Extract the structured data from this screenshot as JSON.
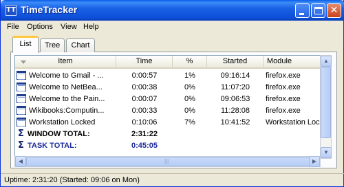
{
  "window": {
    "title": "TimeTracker",
    "icon_glyph": "TT"
  },
  "menu": [
    {
      "label": "File"
    },
    {
      "label": "Options"
    },
    {
      "label": "View"
    },
    {
      "label": "Help"
    }
  ],
  "tabs": [
    {
      "label": "List",
      "active": true
    },
    {
      "label": "Tree",
      "active": false
    },
    {
      "label": "Chart",
      "active": false
    }
  ],
  "list": {
    "columns": [
      "Item",
      "Time",
      "%",
      "Started",
      "Module"
    ],
    "rows": [
      {
        "item": "Welcome to Gmail - ...",
        "time": "0:00:57",
        "pct": "1%",
        "started": "09:16:14",
        "module": "firefox.exe"
      },
      {
        "item": "Welcome to NetBea...",
        "time": "0:00:38",
        "pct": "0%",
        "started": "11:07:20",
        "module": "firefox.exe"
      },
      {
        "item": "Welcome to the Pain...",
        "time": "0:00:07",
        "pct": "0%",
        "started": "09:06:53",
        "module": "firefox.exe"
      },
      {
        "item": "Wikibooks:Computin...",
        "time": "0:00:33",
        "pct": "0%",
        "started": "11:28:08",
        "module": "firefox.exe"
      },
      {
        "item": "Workstation Locked",
        "time": "0:10:06",
        "pct": "7%",
        "started": "10:41:52",
        "module": "Workstation Locked"
      }
    ],
    "totals": [
      {
        "label": "WINDOW TOTAL:",
        "time": "2:31:22"
      },
      {
        "label": "TASK TOTAL:",
        "time": "0:45:05"
      }
    ]
  },
  "status": {
    "text": "Uptime: 2:31:20 (Started: 09:06 on Mon)"
  },
  "colors": {
    "titlebar": "#0d4fd8",
    "task_total": "#1a2a9a",
    "active_tab_accent": "#ffc83c"
  }
}
